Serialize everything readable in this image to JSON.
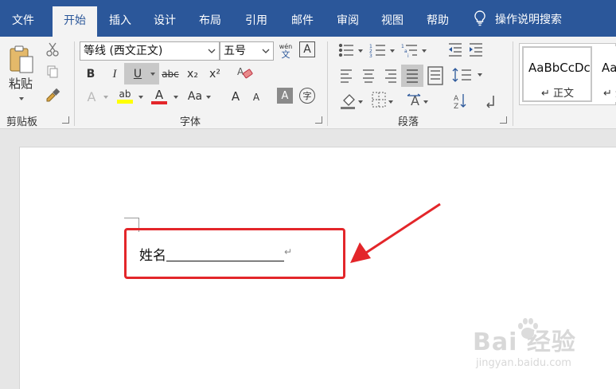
{
  "tabs": [
    {
      "label": "文件",
      "active": false
    },
    {
      "label": "开始",
      "active": true
    },
    {
      "label": "插入",
      "active": false
    },
    {
      "label": "设计",
      "active": false
    },
    {
      "label": "布局",
      "active": false
    },
    {
      "label": "引用",
      "active": false
    },
    {
      "label": "邮件",
      "active": false
    },
    {
      "label": "审阅",
      "active": false
    },
    {
      "label": "视图",
      "active": false
    },
    {
      "label": "帮助",
      "active": false
    }
  ],
  "tell_me": "操作说明搜索",
  "clipboard": {
    "paste_label": "粘贴",
    "group_label": "剪贴板"
  },
  "font": {
    "group_label": "字体",
    "font_name": "等线 (西文正文)",
    "font_size": "五号",
    "bold": "B",
    "italic": "I",
    "underline": "U",
    "strike": "abc",
    "subscript": "x₂",
    "superscript": "x²",
    "highlight": "ab",
    "font_color": "A",
    "change_case": "Aa",
    "grow": "A",
    "shrink": "A",
    "char_shading": "A",
    "enclose": "字",
    "phonetic_top": "wén",
    "phonetic_bottom": "文",
    "border_char": "A"
  },
  "paragraph": {
    "group_label": "段落"
  },
  "styles": [
    {
      "sample": "AaBbCcDc",
      "name": "↵ 正文"
    },
    {
      "sample": "AaBbCcDc",
      "name": "↵ 无"
    }
  ],
  "document": {
    "line_text": "姓名",
    "paragraph_mark": "↵"
  },
  "watermark": {
    "brand": "Bai 经验",
    "sub": "jingyan.baidu.com"
  },
  "colors": {
    "accent": "#2b579a",
    "highlight_yellow": "#ffff00",
    "font_red": "#e3262a",
    "callout_red": "#e3262a"
  }
}
